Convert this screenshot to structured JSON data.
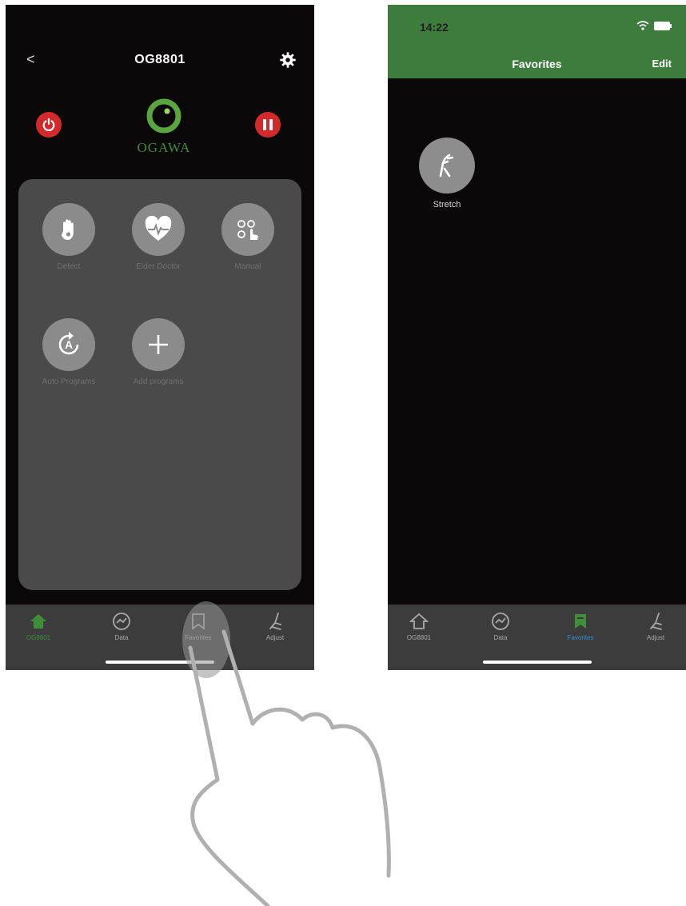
{
  "left_screen": {
    "title": "OG8801",
    "back_label": "<",
    "logo_text": "OGAWA",
    "functions": [
      {
        "label": "Detect",
        "icon": "hand-icon"
      },
      {
        "label": "Elder Doctor",
        "icon": "heart-pulse-icon"
      },
      {
        "label": "Manual",
        "icon": "manual-touch-icon"
      },
      {
        "label": "Auto Programs",
        "icon": "auto-a-icon"
      },
      {
        "label": "Add programs",
        "icon": "plus-icon"
      }
    ],
    "tabs": [
      {
        "label": "OG8801",
        "icon": "home-icon",
        "active": true
      },
      {
        "label": "Data",
        "icon": "chart-circle-icon",
        "active": false
      },
      {
        "label": "Favorites",
        "icon": "bookmark-icon",
        "active": false
      },
      {
        "label": "Adjust",
        "icon": "chair-icon",
        "active": false
      }
    ]
  },
  "right_screen": {
    "status_time": "14:22",
    "title": "Favorites",
    "edit_label": "Edit",
    "favorites": [
      {
        "label": "Stretch",
        "icon": "stretch-icon"
      }
    ],
    "tabs": [
      {
        "label": "OG8801",
        "icon": "home-icon",
        "active": false
      },
      {
        "label": "Data",
        "icon": "chart-circle-icon",
        "active": false
      },
      {
        "label": "Favorites",
        "icon": "bookmark-icon",
        "active": true
      },
      {
        "label": "Adjust",
        "icon": "chair-icon",
        "active": false
      }
    ]
  },
  "colors": {
    "brand_green": "#3e7c3e",
    "power_red": "#d22a2a",
    "tab_active_green": "#3f8f3a",
    "tab_active_label": "#2f8fd0"
  }
}
